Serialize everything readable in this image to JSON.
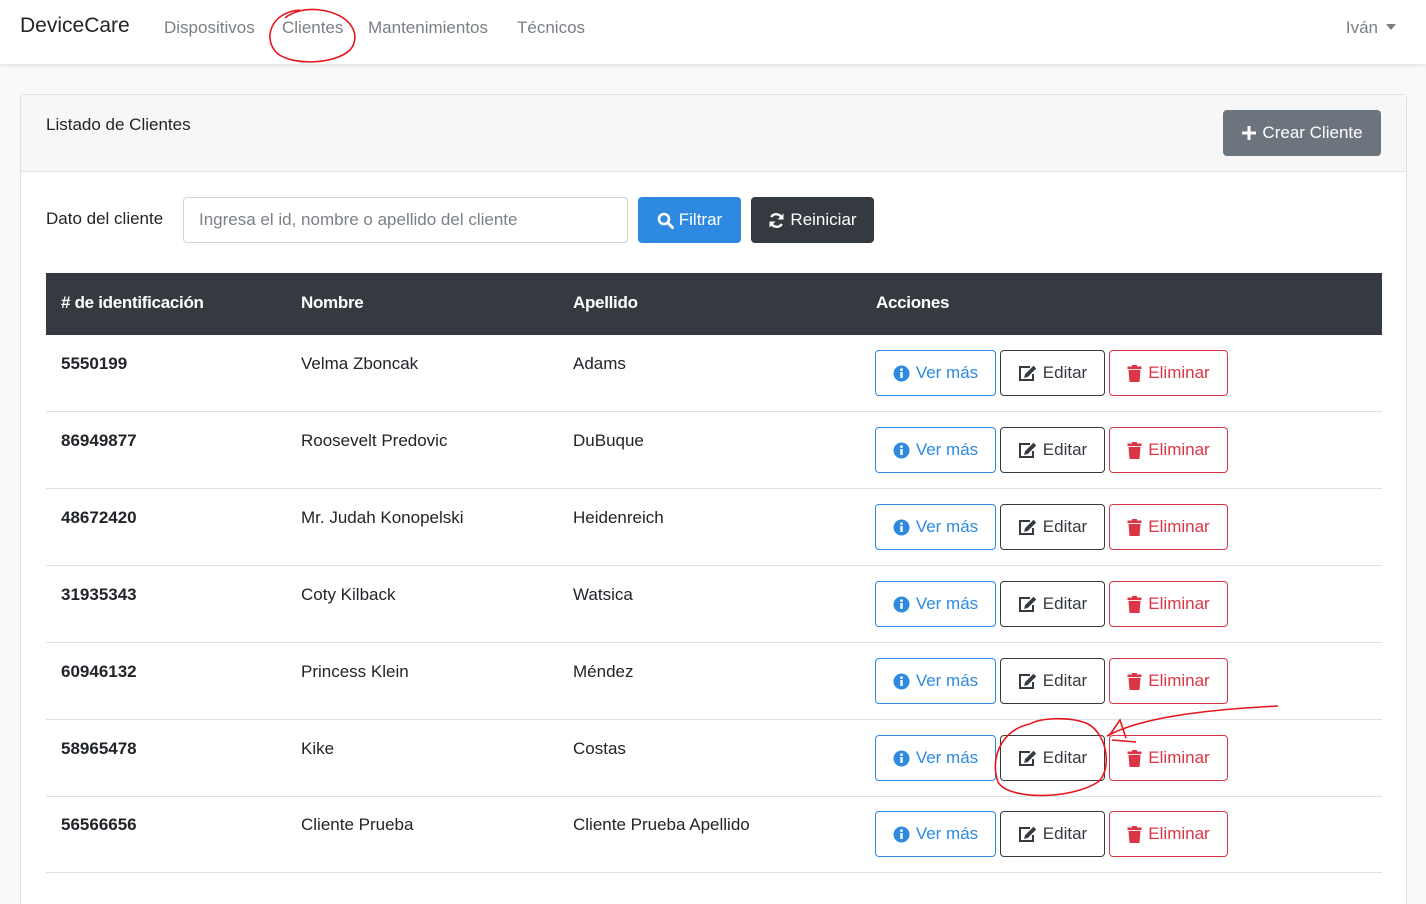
{
  "app": {
    "brand": "DeviceCare"
  },
  "nav": {
    "items": [
      {
        "label": "Dispositivos"
      },
      {
        "label": "Clientes"
      },
      {
        "label": "Mantenimientos"
      },
      {
        "label": "Técnicos"
      }
    ],
    "user": "Iván"
  },
  "card": {
    "title": "Listado de Clientes",
    "create_label": "Crear Cliente"
  },
  "filter": {
    "label": "Dato del cliente",
    "placeholder": "Ingresa el id, nombre o apellido del cliente",
    "filter_label": "Filtrar",
    "reset_label": "Reiniciar"
  },
  "table": {
    "headers": [
      "# de identificación",
      "Nombre",
      "Apellido",
      "Acciones"
    ],
    "rows": [
      {
        "id": "5550199",
        "nombre": "Velma Zboncak",
        "apellido": "Adams"
      },
      {
        "id": "86949877",
        "nombre": "Roosevelt Predovic",
        "apellido": "DuBuque"
      },
      {
        "id": "48672420",
        "nombre": "Mr. Judah Konopelski",
        "apellido": "Heidenreich"
      },
      {
        "id": "31935343",
        "nombre": "Coty Kilback",
        "apellido": "Watsica"
      },
      {
        "id": "60946132",
        "nombre": "Princess Klein",
        "apellido": "Méndez"
      },
      {
        "id": "58965478",
        "nombre": "Kike",
        "apellido": "Costas"
      },
      {
        "id": "56566656",
        "nombre": "Cliente Prueba",
        "apellido": "Cliente Prueba Apellido"
      }
    ],
    "actions": {
      "view": "Ver más",
      "edit": "Editar",
      "delete": "Eliminar"
    }
  },
  "colors": {
    "primary": "#2d8ae0",
    "dark": "#343a40",
    "danger": "#dc3545",
    "secondary": "#6c757d",
    "annotation": "#e8141c"
  }
}
